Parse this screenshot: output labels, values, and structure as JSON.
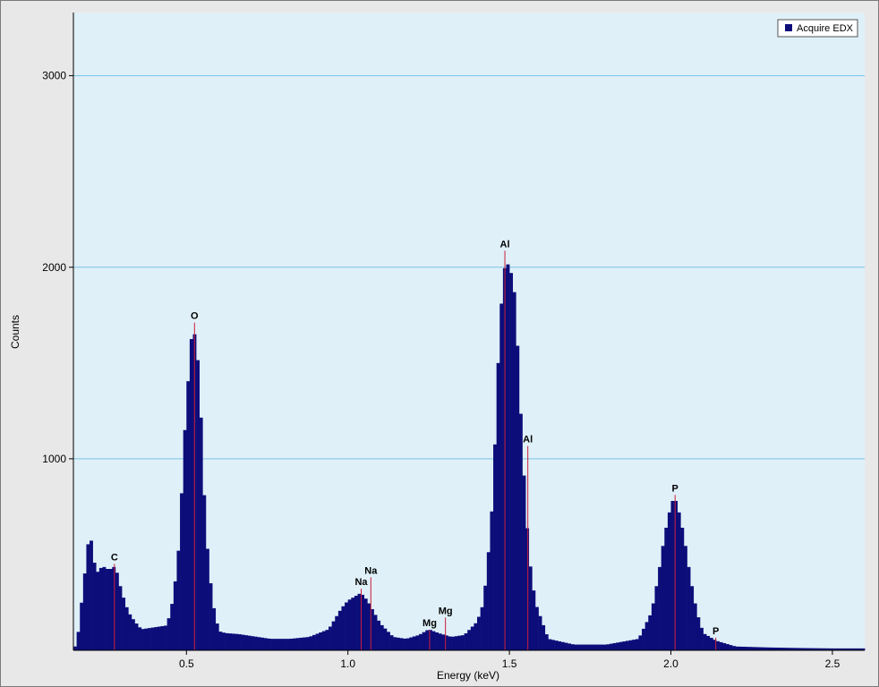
{
  "chart_data": {
    "type": "bar",
    "title": "",
    "xlabel": "Energy (keV)",
    "ylabel": "Counts",
    "xlim": [
      0.15,
      2.6
    ],
    "ylim": [
      0,
      3330
    ],
    "x_ticks": [
      0.5,
      1.0,
      1.5,
      2.0,
      2.5
    ],
    "x_tick_labels": [
      "0.5",
      "1.0",
      "1.5",
      "2.0",
      "2.5"
    ],
    "y_ticks": [
      1000,
      2000,
      3000
    ],
    "y_tick_labels": [
      "1000",
      "2000",
      "3000"
    ],
    "grid": "horizontal",
    "legend_position": "top-right",
    "colors": {
      "plot_background": "#dff0f8",
      "bars": "#0d0d7a",
      "grid": "#79c3e8",
      "markers": "#cc1f3a",
      "frame": "#e8e8e8"
    },
    "series": [
      {
        "name": "Acquire EDX",
        "x": [
          0.16,
          0.2,
          0.22,
          0.24,
          0.26,
          0.28,
          0.3,
          0.32,
          0.34,
          0.36,
          0.4,
          0.44,
          0.46,
          0.48,
          0.49,
          0.5,
          0.51,
          0.52,
          0.53,
          0.54,
          0.55,
          0.56,
          0.58,
          0.6,
          0.62,
          0.66,
          0.7,
          0.76,
          0.82,
          0.88,
          0.94,
          0.98,
          1.0,
          1.02,
          1.04,
          1.06,
          1.08,
          1.1,
          1.14,
          1.18,
          1.22,
          1.25,
          1.28,
          1.32,
          1.36,
          1.4,
          1.42,
          1.44,
          1.45,
          1.46,
          1.47,
          1.48,
          1.49,
          1.5,
          1.51,
          1.52,
          1.53,
          1.54,
          1.56,
          1.58,
          1.62,
          1.7,
          1.8,
          1.9,
          1.94,
          1.96,
          1.98,
          2.0,
          2.01,
          2.02,
          2.04,
          2.06,
          2.08,
          2.1,
          2.14,
          2.2,
          2.3,
          2.4,
          2.5,
          2.6
        ],
        "values": [
          20,
          630,
          400,
          440,
          420,
          440,
          300,
          200,
          150,
          110,
          120,
          130,
          280,
          600,
          1040,
          1260,
          1550,
          1700,
          1600,
          1430,
          1000,
          620,
          260,
          100,
          90,
          85,
          75,
          60,
          60,
          70,
          110,
          220,
          260,
          280,
          300,
          260,
          200,
          140,
          70,
          60,
          80,
          110,
          90,
          70,
          80,
          150,
          250,
          600,
          850,
          1300,
          1700,
          1920,
          2070,
          1960,
          1980,
          1760,
          1420,
          1050,
          500,
          250,
          60,
          30,
          30,
          60,
          200,
          380,
          600,
          760,
          800,
          760,
          600,
          380,
          200,
          90,
          50,
          20,
          15,
          12,
          10,
          10
        ]
      }
    ],
    "element_markers": [
      {
        "element": "C",
        "energy": 0.277,
        "label": "C",
        "label_y": 470
      },
      {
        "element": "O",
        "energy": 0.525,
        "label": "O",
        "label_y": 1730
      },
      {
        "element": "Na",
        "energy": 1.041,
        "label": "Na",
        "label_y": 340
      },
      {
        "element": "Na",
        "energy": 1.071,
        "label": "Na",
        "label_y": 400
      },
      {
        "element": "Mg",
        "energy": 1.253,
        "label": "Mg",
        "label_y": 125
      },
      {
        "element": "Mg",
        "energy": 1.302,
        "label": "Mg",
        "label_y": 190
      },
      {
        "element": "Al",
        "energy": 1.486,
        "label": "Al",
        "label_y": 2105
      },
      {
        "element": "Al",
        "energy": 1.557,
        "label": "Al",
        "label_y": 1085
      },
      {
        "element": "P",
        "energy": 2.013,
        "label": "P",
        "label_y": 830
      },
      {
        "element": "P",
        "energy": 2.139,
        "label": "P",
        "label_y": 85
      }
    ]
  }
}
